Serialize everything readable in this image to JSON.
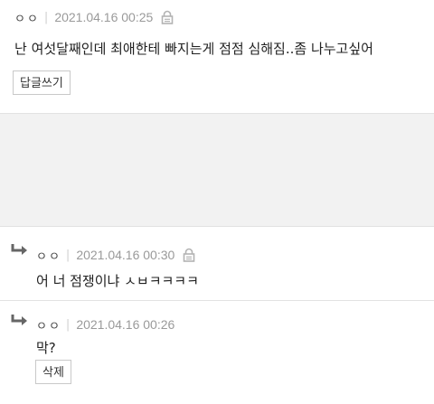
{
  "comments": [
    {
      "author": "ㅇㅇ",
      "separator": "|",
      "date": "2021.04.16 00:25",
      "text": "난 여섯달째인데 최애한테 빠지는게 점점 심해짐..좀 나누고싶어",
      "button_label": "답글쓰기",
      "lock_icon": "lock-icon"
    },
    {
      "author": "ㅇㅇ",
      "separator": "|",
      "date": "2021.04.16 00:30",
      "text": "어 너 점쟁이냐 ㅅㅂㅋㅋㅋㅋ",
      "reply_icon": "reply-arrow-icon",
      "lock_icon": "lock-icon"
    },
    {
      "author": "ㅇㅇ",
      "separator": "|",
      "date": "2021.04.16 00:26",
      "text": "막?",
      "button_label": "삭제",
      "reply_icon": "reply-arrow-icon"
    }
  ],
  "colors": {
    "divider": "#e2e2e2",
    "gap_background": "#f2f2f2",
    "date_text": "#9a9a9a",
    "reply_icon": "#666666"
  }
}
